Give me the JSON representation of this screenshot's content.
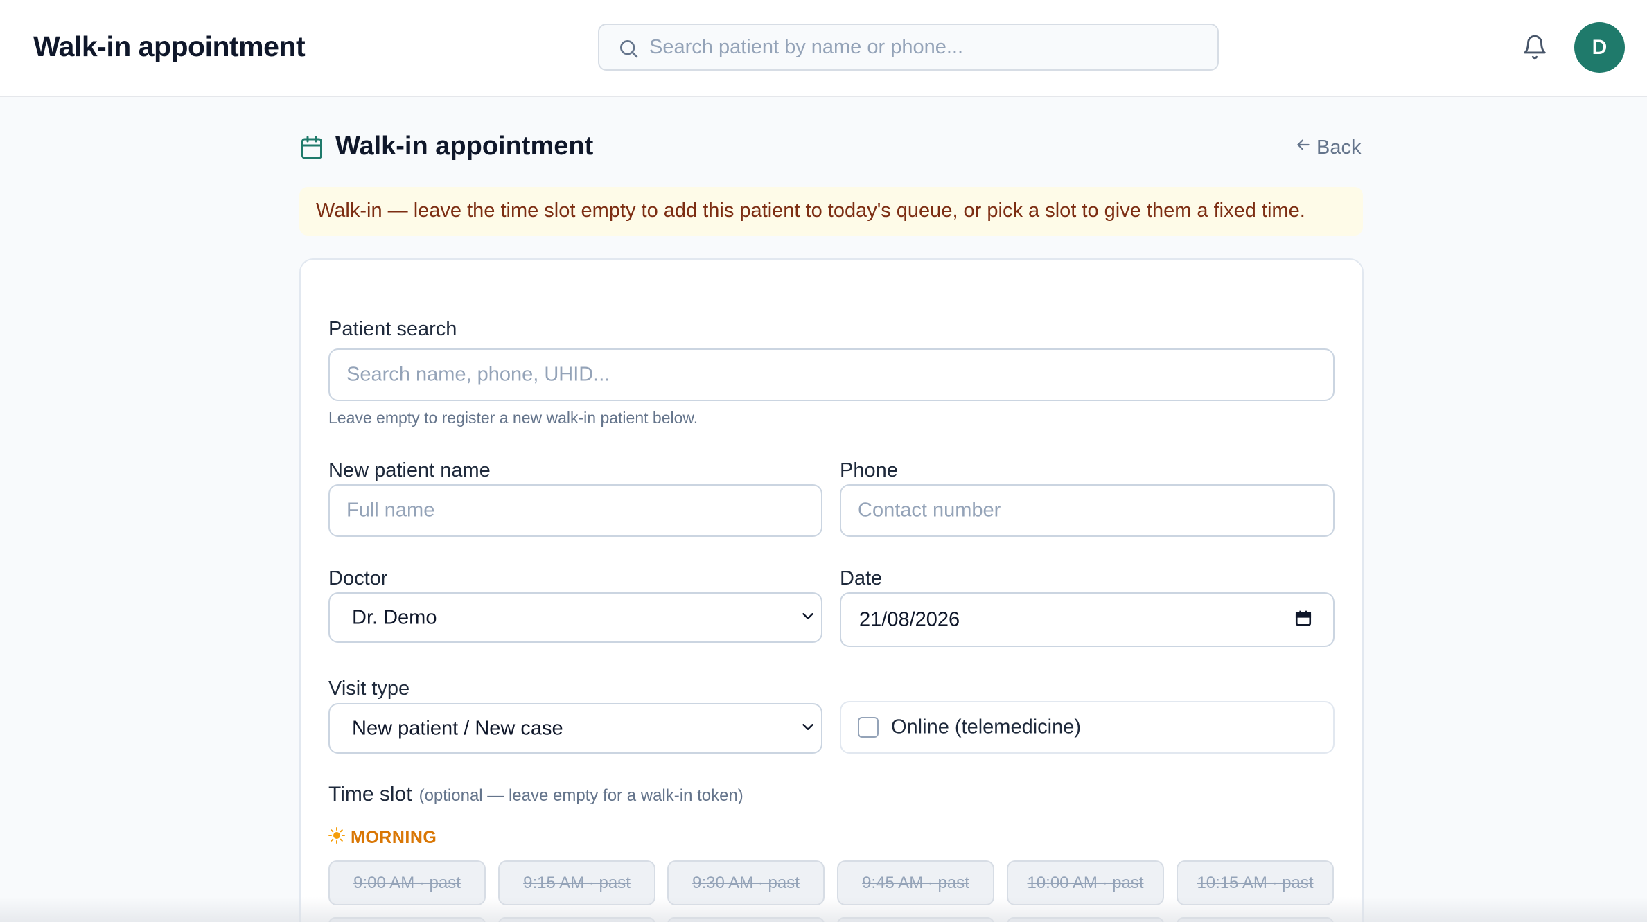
{
  "header": {
    "title": "Walk-in appointment",
    "search_placeholder": "Search patient by name or phone...",
    "avatar_initial": "D"
  },
  "page": {
    "title": "Walk-in appointment",
    "back_label": "Back",
    "notice": "Walk-in — leave the time slot empty to add this patient to today's queue, or pick a slot to give them a fixed time."
  },
  "form": {
    "patient_search": {
      "label": "Patient search",
      "placeholder": "Search name, phone, UHID...",
      "hint": "Leave empty to register a new walk-in patient below."
    },
    "new_patient_name": {
      "label": "New patient name",
      "placeholder": "Full name"
    },
    "phone": {
      "label": "Phone",
      "placeholder": "Contact number"
    },
    "doctor": {
      "label": "Doctor",
      "value": "Dr. Demo"
    },
    "date": {
      "label": "Date",
      "value": "21/08/2026"
    },
    "visit_type": {
      "label": "Visit type",
      "value": "New patient / New case"
    },
    "online": {
      "label": "Online (telemedicine)",
      "checked": false
    },
    "time_slot": {
      "label": "Time slot",
      "optional_note": "(optional — leave empty for a walk-in token)",
      "morning_label": "MORNING",
      "slots": [
        {
          "label": "9:00 AM · past",
          "disabled": true
        },
        {
          "label": "9:15 AM · past",
          "disabled": true
        },
        {
          "label": "9:30 AM · past",
          "disabled": true
        },
        {
          "label": "9:45 AM · past",
          "disabled": true
        },
        {
          "label": "10:00 AM · past",
          "disabled": true
        },
        {
          "label": "10:15 AM · past",
          "disabled": true
        }
      ]
    }
  },
  "colors": {
    "accent": "#1f7a6b",
    "notice_bg": "#fefbe8",
    "notice_text": "#7c2d12",
    "morning": "#d97706"
  }
}
